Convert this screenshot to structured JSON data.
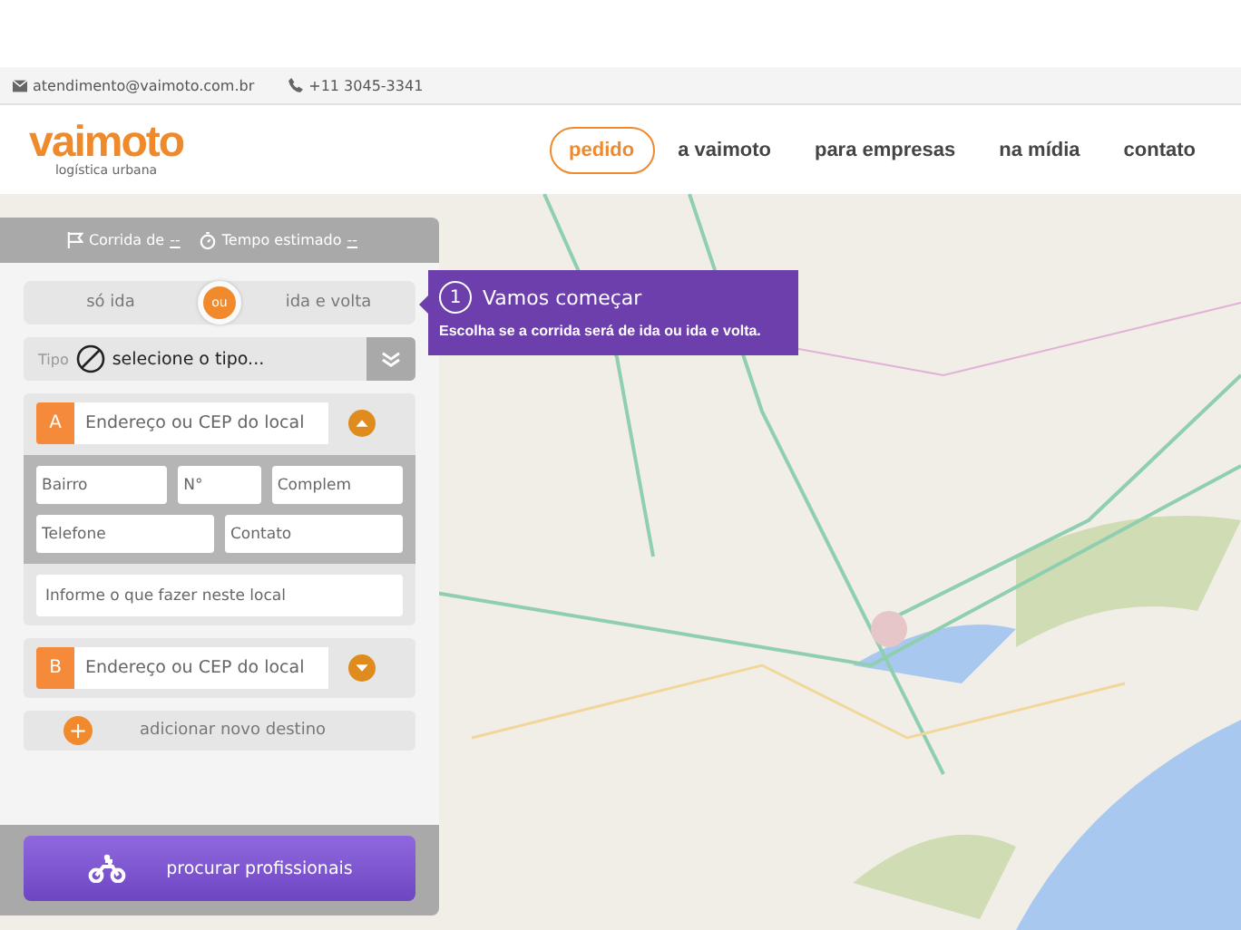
{
  "top_bar": {
    "email": "atendimento@vaimoto.com.br",
    "phone": "+11 3045-3341"
  },
  "logo": {
    "name": "vaimoto",
    "tagline": "logística urbana"
  },
  "nav": [
    {
      "label": "pedido",
      "selected": true
    },
    {
      "label": "a vaimoto",
      "selected": false
    },
    {
      "label": "para empresas",
      "selected": false
    },
    {
      "label": "na mídia",
      "selected": false
    },
    {
      "label": "contato",
      "selected": false
    }
  ],
  "panel": {
    "summary": [
      {
        "kind": "flag",
        "label": "Corrida de",
        "value": "--"
      },
      {
        "kind": "timer",
        "label": "Tempo estimado",
        "value": "--"
      }
    ],
    "trip_toggle": {
      "separator": "ou",
      "options": [
        {
          "label": "só ida",
          "selected": false
        },
        {
          "label": "ida e volta",
          "selected": false
        }
      ]
    },
    "type_field": {
      "label": "Tipo",
      "value": "selecione o tipo..."
    },
    "stops": [
      {
        "letter": "A",
        "placeholder": "Endereço ou CEP do local",
        "expanded": true,
        "details": [
          [
            {
              "placeholder": "Bairro"
            },
            {
              "placeholder": "N°"
            },
            {
              "placeholder": "Complem"
            }
          ],
          [
            {
              "placeholder": "Telefone"
            },
            {
              "placeholder": "Contato"
            }
          ]
        ],
        "note_placeholder": "Informe o que fazer neste local"
      },
      {
        "letter": "B",
        "placeholder": "Endereço ou CEP do local",
        "expanded": false
      }
    ],
    "add_destination": {
      "icon": "+",
      "label": "adicionar novo destino"
    },
    "search_button": "procurar profissionais"
  },
  "tooltip": {
    "step": "1",
    "title": "Vamos começar",
    "text": "Escolha se a corrida será de ida ou ida e volta."
  }
}
